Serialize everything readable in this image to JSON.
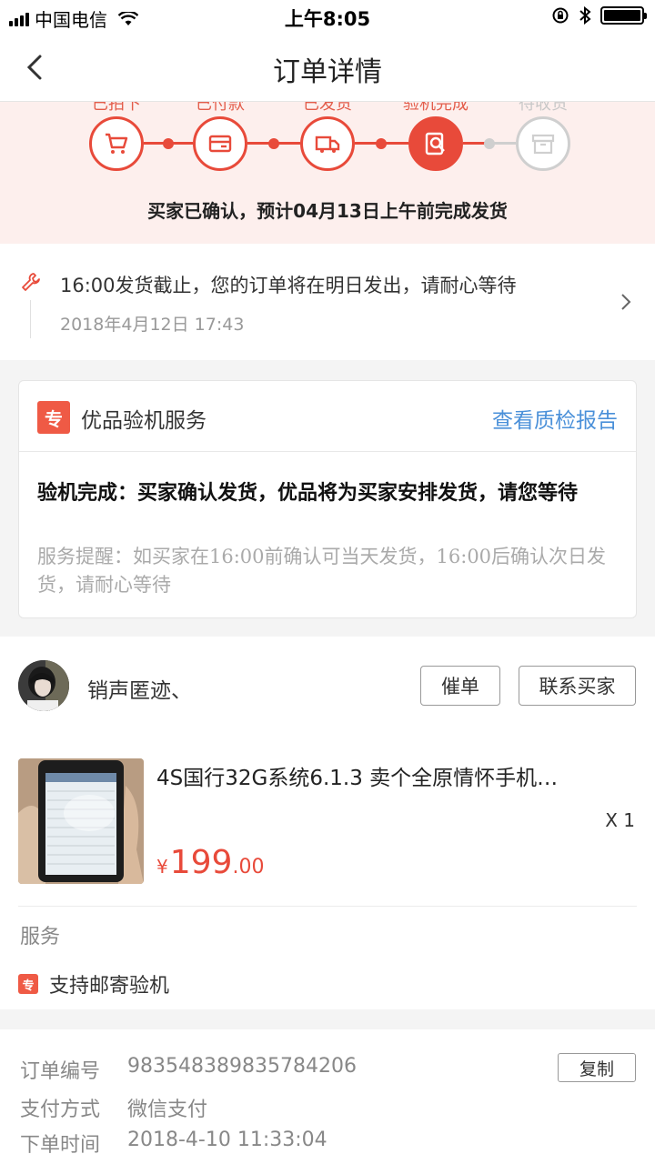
{
  "status_bar": {
    "carrier": "中国电信",
    "time": "上午8:05"
  },
  "nav": {
    "title": "订单详情"
  },
  "progress": {
    "steps": [
      {
        "label": "已拍下",
        "icon": "cart-icon",
        "state": "done"
      },
      {
        "label": "已付款",
        "icon": "card-icon",
        "state": "done"
      },
      {
        "label": "已发货",
        "icon": "truck-icon",
        "state": "done"
      },
      {
        "label": "验机完成",
        "icon": "inspect-icon",
        "state": "active"
      },
      {
        "label": "待收货",
        "icon": "box-icon",
        "state": "pending"
      }
    ],
    "message": "买家已确认，预计04月13日上午前完成发货"
  },
  "notice": {
    "text": "16:00发货截止，您的订单将在明日发出，请耐心等待",
    "time": "2018年4月12日 17:43"
  },
  "service_card": {
    "badge": "专",
    "title": "优品验机服务",
    "link": "查看质检报告",
    "status": "验机完成：买家确认发货，优品将为买家安排发货，请您等待",
    "reminder": "服务提醒：如买家在16:00前确认可当天发货，16:00后确认次日发货，请耐心等待"
  },
  "seller": {
    "name": "销声匿迹、",
    "urge_button": "催单",
    "contact_button": "联系买家"
  },
  "product": {
    "title": "4S国行32G系统6.1.3 卖个全原情怀手机…",
    "quantity": "X 1",
    "currency": "¥",
    "price_int": "199",
    "price_dec": ".00"
  },
  "services": {
    "label": "服务",
    "badge": "专",
    "item": "支持邮寄验机"
  },
  "order_info": {
    "copy_button": "复制",
    "rows": [
      {
        "key": "订单编号",
        "value": "983548389835784206"
      },
      {
        "key": "支付方式",
        "value": "微信支付"
      },
      {
        "key": "下单时间",
        "value": "2018-4-10 11:33:04"
      }
    ]
  },
  "colors": {
    "accent": "#e84a3a",
    "link": "#4a90d9",
    "progress_bg": "#fdefed"
  }
}
